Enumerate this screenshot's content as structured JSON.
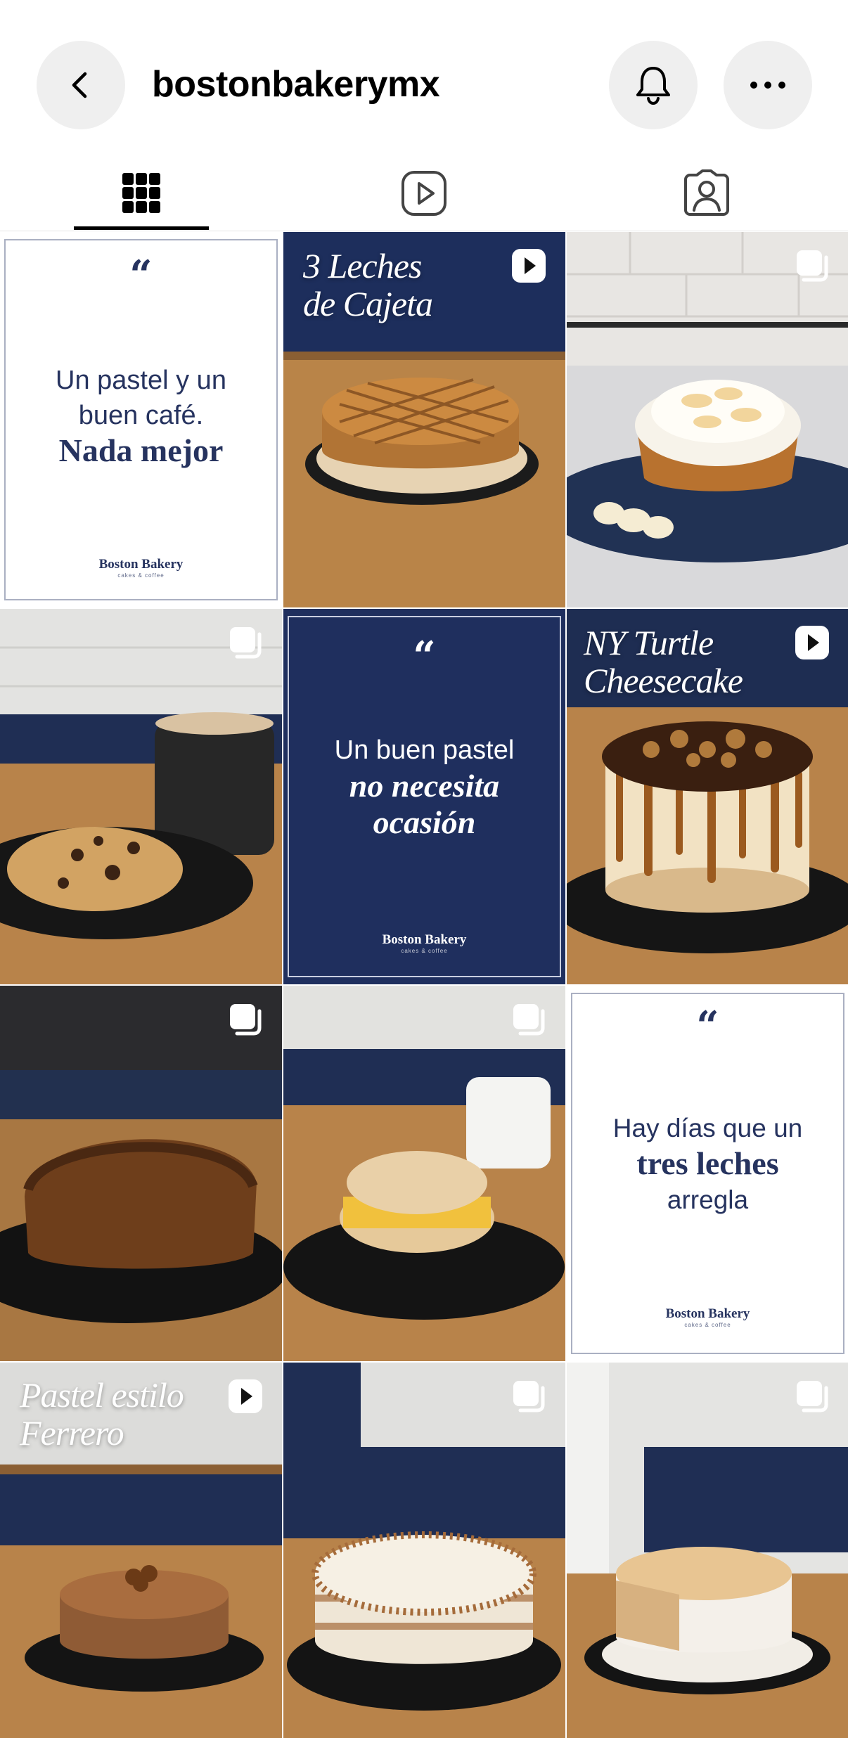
{
  "header": {
    "username": "bostonbakerymx",
    "icons": {
      "back": "back-chevron-icon",
      "bell": "bell-icon",
      "more": "more-icon"
    }
  },
  "tabs": [
    {
      "name": "grid",
      "icon": "grid-icon",
      "selected": true
    },
    {
      "name": "reels",
      "icon": "reels-icon",
      "selected": false
    },
    {
      "name": "tagged",
      "icon": "tagged-icon",
      "selected": false
    }
  ],
  "colors": {
    "navy": "#1f2f5e",
    "wood": "#b8834a",
    "badge": "#ffffff"
  },
  "posts": [
    {
      "type": "quote",
      "theme": "light",
      "line1": "Un pastel y un",
      "line2": "buen café.",
      "line3": "Nada mejor",
      "brand": "Boston Bakery",
      "brand_sub": "cakes & coffee"
    },
    {
      "type": "reel",
      "title_line1": "3 Leches",
      "title_line2": "de Cajeta",
      "badge": "reel-icon"
    },
    {
      "type": "carousel",
      "subject": "banana cream pie",
      "badge": "carousel-icon"
    },
    {
      "type": "carousel",
      "subject": "cookie and coffee",
      "badge": "carousel-icon"
    },
    {
      "type": "quote",
      "theme": "dark",
      "line1": "Un buen pastel",
      "line2": "no necesita",
      "line3": "ocasión",
      "brand": "Boston Bakery",
      "brand_sub": "cakes & coffee"
    },
    {
      "type": "reel",
      "title_line1": "NY Turtle",
      "title_line2": "Cheesecake",
      "badge": "reel-icon"
    },
    {
      "type": "carousel",
      "subject": "banana bread",
      "badge": "carousel-icon"
    },
    {
      "type": "carousel",
      "subject": "breakfast sandwich",
      "badge": "carousel-icon"
    },
    {
      "type": "quote",
      "theme": "light",
      "line1": "Hay días que un",
      "line2": "tres leches",
      "line3": "arregla",
      "brand": "Boston Bakery",
      "brand_sub": "cakes & coffee"
    },
    {
      "type": "reel",
      "title_line1": "Pastel estilo",
      "title_line2": "Ferrero",
      "badge": "reel-icon"
    },
    {
      "type": "carousel",
      "subject": "carrot cake",
      "badge": "carousel-icon"
    },
    {
      "type": "carousel",
      "subject": "tres leches slice",
      "badge": "carousel-icon"
    }
  ]
}
